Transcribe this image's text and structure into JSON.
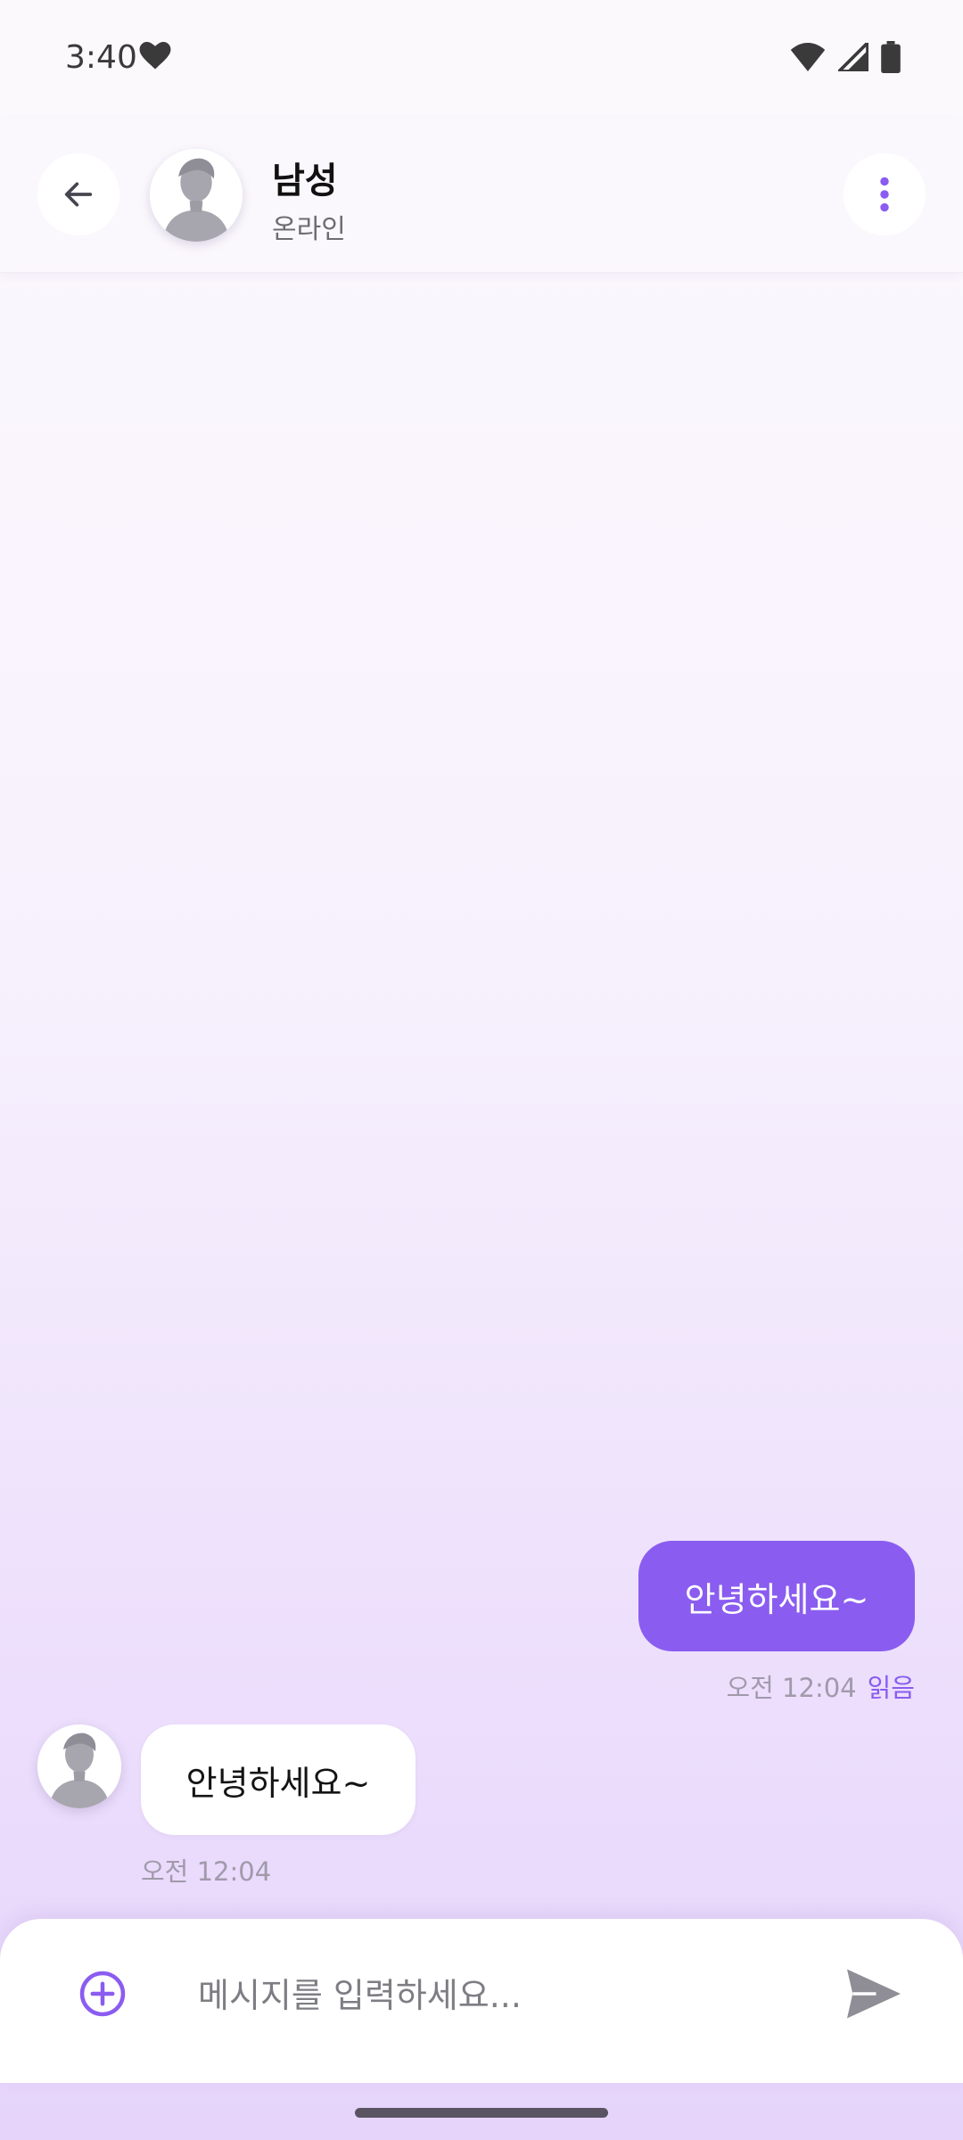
{
  "status_bar": {
    "time": "3:40",
    "icons": [
      "heart-icon",
      "wifi-icon",
      "signal-icon",
      "battery-icon"
    ]
  },
  "header": {
    "back_icon": "arrow-left-icon",
    "name": "남성",
    "status": "온라인",
    "more_icon": "more-vertical-icon"
  },
  "messages": [
    {
      "direction": "outgoing",
      "text": "안녕하세요~",
      "time": "오전 12:04",
      "read_label": "읽음"
    },
    {
      "direction": "incoming",
      "text": "안녕하세요~",
      "time": "오전 12:04"
    }
  ],
  "composer": {
    "placeholder": "메시지를 입력하세요...",
    "value": "",
    "add_icon": "plus-circle-icon",
    "send_icon": "send-icon"
  },
  "colors": {
    "accent": "#8a5cf0",
    "background_top": "#fcf9fd",
    "background_bottom": "#e6d4fb"
  }
}
